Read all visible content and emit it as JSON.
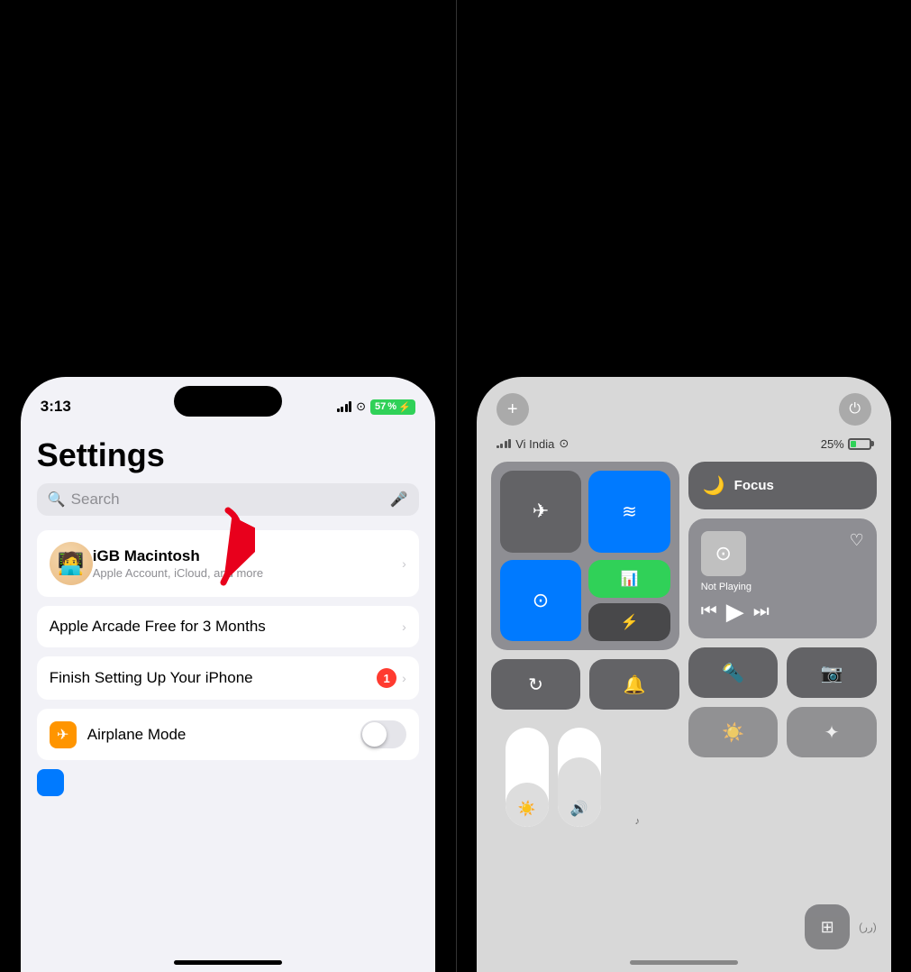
{
  "left": {
    "status": {
      "time": "3:13",
      "battery": "57",
      "battery_charging": true
    },
    "title": "Settings",
    "search": {
      "placeholder": "Search"
    },
    "account": {
      "name": "iGB Macintosh",
      "subtitle": "Apple Account, iCloud, and more"
    },
    "items": [
      {
        "label": "Apple Arcade Free for 3 Months"
      },
      {
        "label": "Finish Setting Up Your iPhone",
        "badge": "1"
      },
      {
        "label": "Airplane Mode"
      }
    ]
  },
  "right": {
    "status": {
      "carrier": "Vi India",
      "battery_percent": "25%"
    },
    "controls": {
      "add_label": "+",
      "power_label": "⏻",
      "focus_label": "Focus",
      "now_playing_label": "Not Playing"
    }
  },
  "icons": {
    "search": "🔍",
    "mic": "🎤",
    "chevron": "›",
    "airplane": "✈",
    "moon": "🌙",
    "wifi": "⊙",
    "bluetooth": "⚡",
    "lock_rotation": "↻",
    "bell": "🔔",
    "play": "▶",
    "prev": "⏮",
    "next": "⏭",
    "torch": "🔦",
    "camera": "📷",
    "heart": "♡",
    "signal": "📶",
    "airdrop": "≋",
    "cellular": "📊"
  }
}
